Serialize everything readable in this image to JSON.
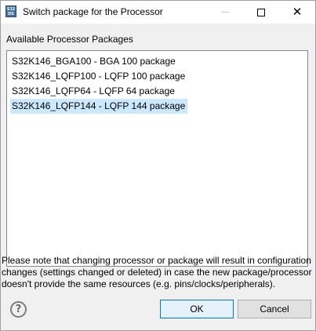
{
  "window": {
    "title": "Switch package for the Processor",
    "app_icon_text": "S32 DS",
    "close_glyph": "✕"
  },
  "packages": {
    "label": "Available Processor Packages",
    "items": [
      "S32K146_BGA100 - BGA 100 package",
      "S32K146_LQFP100 - LQFP 100 package",
      "S32K146_LQFP64 - LQFP 64 package",
      "S32K146_LQFP144 - LQFP 144 package"
    ],
    "selected": "S32K146_LQFP144 - LQFP 144 package"
  },
  "note": "Please note that changing processor or package will result in configuration changes (settings changed or deleted) in case the new package/processor doesn't provide the same resources (e.g. pins/clocks/peripherals).",
  "buttons": {
    "help": "?",
    "ok": "OK",
    "cancel": "Cancel"
  },
  "colors": {
    "selection": "#cce8ff",
    "ok_border": "#0078d7",
    "ok_background": "#e5f1fb"
  }
}
